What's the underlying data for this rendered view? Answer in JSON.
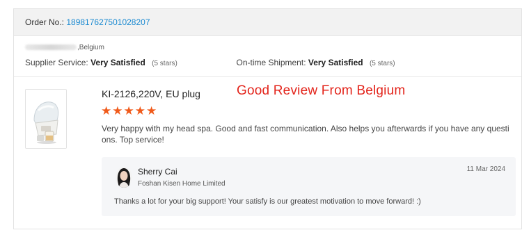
{
  "order": {
    "label": "Order No.:",
    "number": "189817627501028207"
  },
  "buyer": {
    "location": ",Belgium"
  },
  "ratings": {
    "supplier_label": "Supplier Service:",
    "supplier_value": "Very Satisfied",
    "supplier_stars": "(5 stars)",
    "shipment_label": "On-time Shipment:",
    "shipment_value": "Very Satisfied",
    "shipment_stars": "(5 stars)"
  },
  "product": {
    "name": "KI-2126,220V, EU plug",
    "image_icon": "head-spa-machine",
    "rating": 5
  },
  "watermark": "Good Review From Belgium",
  "review": {
    "text": "Very happy with my head spa. Good and fast communication. Also helps you afterwards if you have any questions. Top service!"
  },
  "reply": {
    "name": "Sherry Cai",
    "company": "Foshan Kisen Home Limited",
    "date": "11 Mar 2024",
    "text": "Thanks a lot for your big support! Your satisfy is our greatest motivation to move forward! :)"
  },
  "colors": {
    "link": "#1b8ad1",
    "star": "#f05a1a",
    "watermark": "#e3241b"
  }
}
